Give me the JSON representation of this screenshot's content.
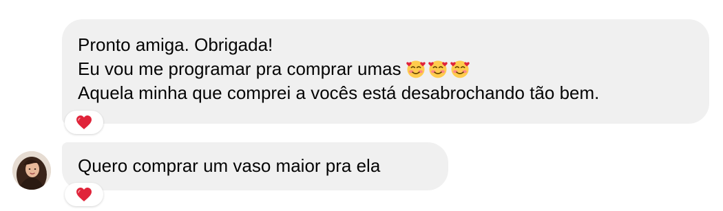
{
  "messages": [
    {
      "lines": [
        "Pronto amiga. Obrigada!",
        "Eu vou me programar pra comprar umas",
        "Aquela minha que comprei a vocês está desabrochando tão bem."
      ],
      "emoji_after_line_2": [
        "smiling-face-with-hearts-icon",
        "smiling-face-with-hearts-icon",
        "smiling-face-with-hearts-icon"
      ],
      "reaction": "red-heart-icon"
    },
    {
      "lines": [
        "Quero comprar um vaso maior pra ela"
      ],
      "reaction": "red-heart-icon",
      "sender_avatar": "avatar"
    }
  ],
  "colors": {
    "bubble_bg": "#f0f0f0",
    "text": "#050505",
    "heart": "#e0243a"
  }
}
